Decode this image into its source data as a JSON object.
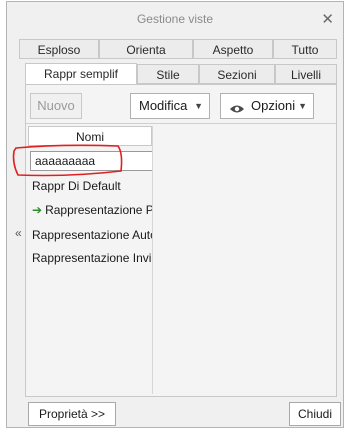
{
  "window": {
    "title": "Gestione viste",
    "close_icon": "close-icon"
  },
  "tabs_row1": [
    {
      "label": "Esploso"
    },
    {
      "label": "Orienta"
    },
    {
      "label": "Aspetto"
    },
    {
      "label": "Tutto"
    }
  ],
  "tabs_row2": [
    {
      "label": "Rappr semplif",
      "active": true
    },
    {
      "label": "Stile"
    },
    {
      "label": "Sezioni"
    },
    {
      "label": "Livelli"
    }
  ],
  "toolbar": {
    "new_label": "Nuovo",
    "edit_label": "Modifica",
    "options_label": "Opzioni",
    "options_icon": "eye-icon",
    "dropdown_icon": "triangle-down-icon"
  },
  "list": {
    "header": "Nomi",
    "edit_value": "aaaaaaaaa",
    "items": [
      {
        "label": "Rappr Di Default"
      },
      {
        "label": "Rappresentazione P",
        "icon": "green-arrow-icon"
      },
      {
        "label": "Rappresentazione Auto"
      },
      {
        "label": "Rappresentazione Invil"
      }
    ]
  },
  "side": {
    "collapse_label": "«"
  },
  "footer": {
    "properties_label": "Proprietà >>",
    "close_label": "Chiudi"
  },
  "annotation": {
    "color": "#e02020"
  },
  "colors": {
    "active_tab_bg": "#ffffff",
    "frame_bg": "#f0f0f0",
    "item_icon": "#2e8b2e"
  }
}
